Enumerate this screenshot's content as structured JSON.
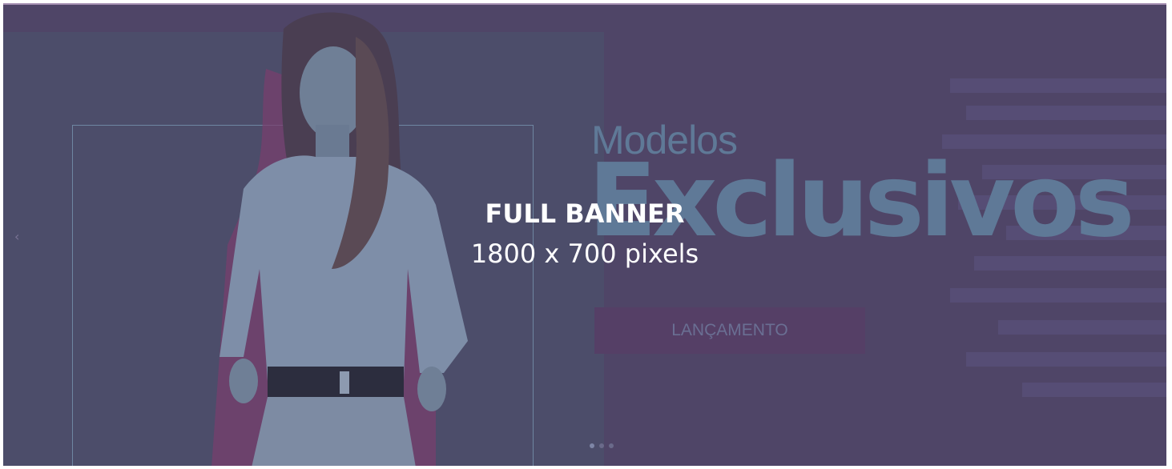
{
  "banner": {
    "headline_small": "Modelos",
    "headline_big": "Exclusivos",
    "cta_label": "LANÇAMENTO",
    "overlay_title": "FULL BANNER",
    "overlay_subtitle": "1800 x 700 pixels",
    "prev_icon": "chevron-left-icon",
    "colors": {
      "background": "#4f4567",
      "headline": "#5f7997",
      "cta_background": "#553f66",
      "overlay_text": "#ffffff"
    }
  },
  "carousel": {
    "dots": [
      {
        "active": true
      },
      {
        "active": false
      },
      {
        "active": false
      }
    ]
  }
}
